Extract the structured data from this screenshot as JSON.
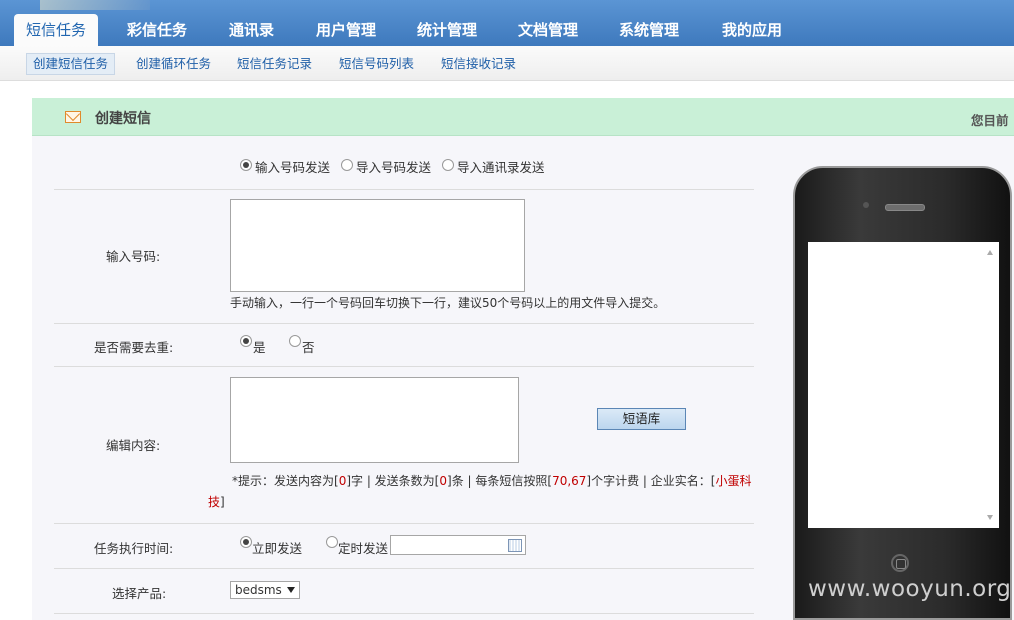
{
  "topnav": {
    "tabs": [
      {
        "label": "短信任务",
        "active": true
      },
      {
        "label": "彩信任务"
      },
      {
        "label": "通讯录"
      },
      {
        "label": "用户管理"
      },
      {
        "label": "统计管理"
      },
      {
        "label": "文档管理"
      },
      {
        "label": "系统管理"
      },
      {
        "label": "我的应用"
      }
    ]
  },
  "subnav": {
    "items": [
      {
        "label": "创建短信任务",
        "active": true
      },
      {
        "label": "创建循环任务"
      },
      {
        "label": "短信任务记录"
      },
      {
        "label": "短信号码列表"
      },
      {
        "label": "短信接收记录"
      }
    ]
  },
  "panel": {
    "title": "创建短信",
    "location_text": "您目前",
    "icon": "mail-icon"
  },
  "form": {
    "send_mode": {
      "options": [
        "输入号码发送",
        "导入号码发送",
        "导入通讯录发送"
      ],
      "selected": "输入号码发送"
    },
    "numbers": {
      "label": "输入号码:",
      "value": "",
      "hint": "手动输入，一行一个号码回车切换下一行，建议50个号码以上的用文件导入提交。"
    },
    "dedupe": {
      "label": "是否需要去重:",
      "options": [
        "是",
        "否"
      ],
      "selected": "是"
    },
    "content": {
      "label": "编辑内容:",
      "value": "",
      "library_button": "短语库",
      "hint_prefix": "*提示：发送内容为[",
      "char_count": "0",
      "hint_mid1": "]字 | 发送条数为[",
      "msg_count": "0",
      "hint_mid2": "]条 | 每条短信按照[",
      "billing": "70,67",
      "hint_mid3": "]个字计费 | 企业实名：[",
      "company_part1": "小蛋科",
      "company_part2": "技",
      "hint_end": "]"
    },
    "schedule": {
      "label": "任务执行时间:",
      "options": [
        "立即发送",
        "定时发送"
      ],
      "selected": "立即发送",
      "datetime_value": ""
    },
    "product": {
      "label": "选择产品:",
      "selected": "bedsms"
    }
  },
  "watermark": "www.wooyun.org",
  "colors": {
    "nav_blue": "#3e79bd",
    "panel_header_green": "#c9f0d7",
    "hint_red": "#c00000",
    "link_blue": "#1f5fa8"
  }
}
